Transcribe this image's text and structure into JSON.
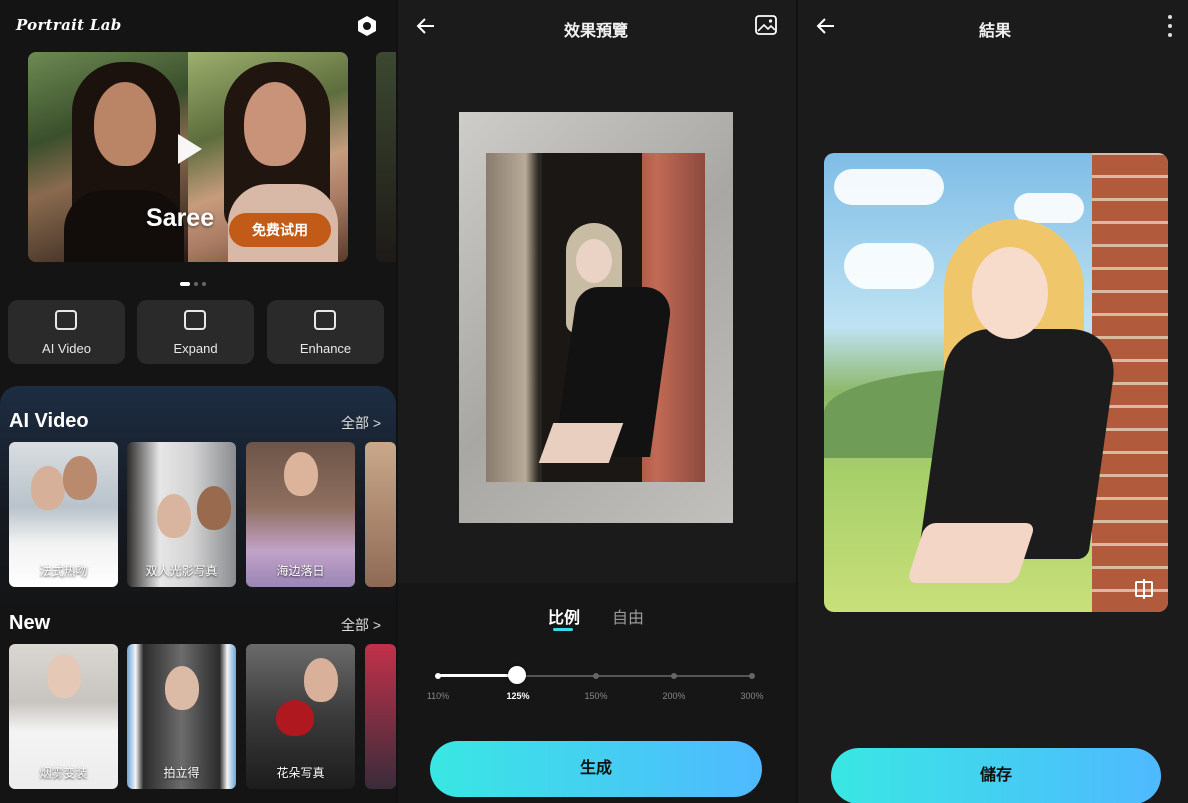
{
  "home": {
    "app_title": "Portrait Lab",
    "banner": {
      "title": "Saree",
      "cta": "免费试用"
    },
    "tools": [
      {
        "label": "AI Video",
        "icon": "ai-video-icon"
      },
      {
        "label": "Expand",
        "icon": "expand-icon"
      },
      {
        "label": "Enhance",
        "icon": "enhance-icon"
      }
    ],
    "sections": [
      {
        "title": "AI Video",
        "more": "全部 >",
        "cards": [
          {
            "caption": "法式热吻"
          },
          {
            "caption": "双人光影写真"
          },
          {
            "caption": "海边落日"
          }
        ]
      },
      {
        "title": "New",
        "more": "全部 >",
        "cards": [
          {
            "caption": "烟雾变装"
          },
          {
            "caption": "拍立得"
          },
          {
            "caption": "花朵写真"
          }
        ]
      }
    ]
  },
  "preview": {
    "title": "效果預覽",
    "tabs": [
      {
        "label": "比例",
        "active": true
      },
      {
        "label": "自由",
        "active": false
      }
    ],
    "ratio_options": [
      "110%",
      "125%",
      "150%",
      "200%",
      "300%"
    ],
    "selected_ratio": "125%",
    "generate_button": "生成"
  },
  "result": {
    "title": "結果",
    "save_button": "儲存"
  },
  "colors": {
    "accent_start": "#39e7e3",
    "accent_end": "#4fb9ff",
    "banner_button": "#c35b18"
  }
}
